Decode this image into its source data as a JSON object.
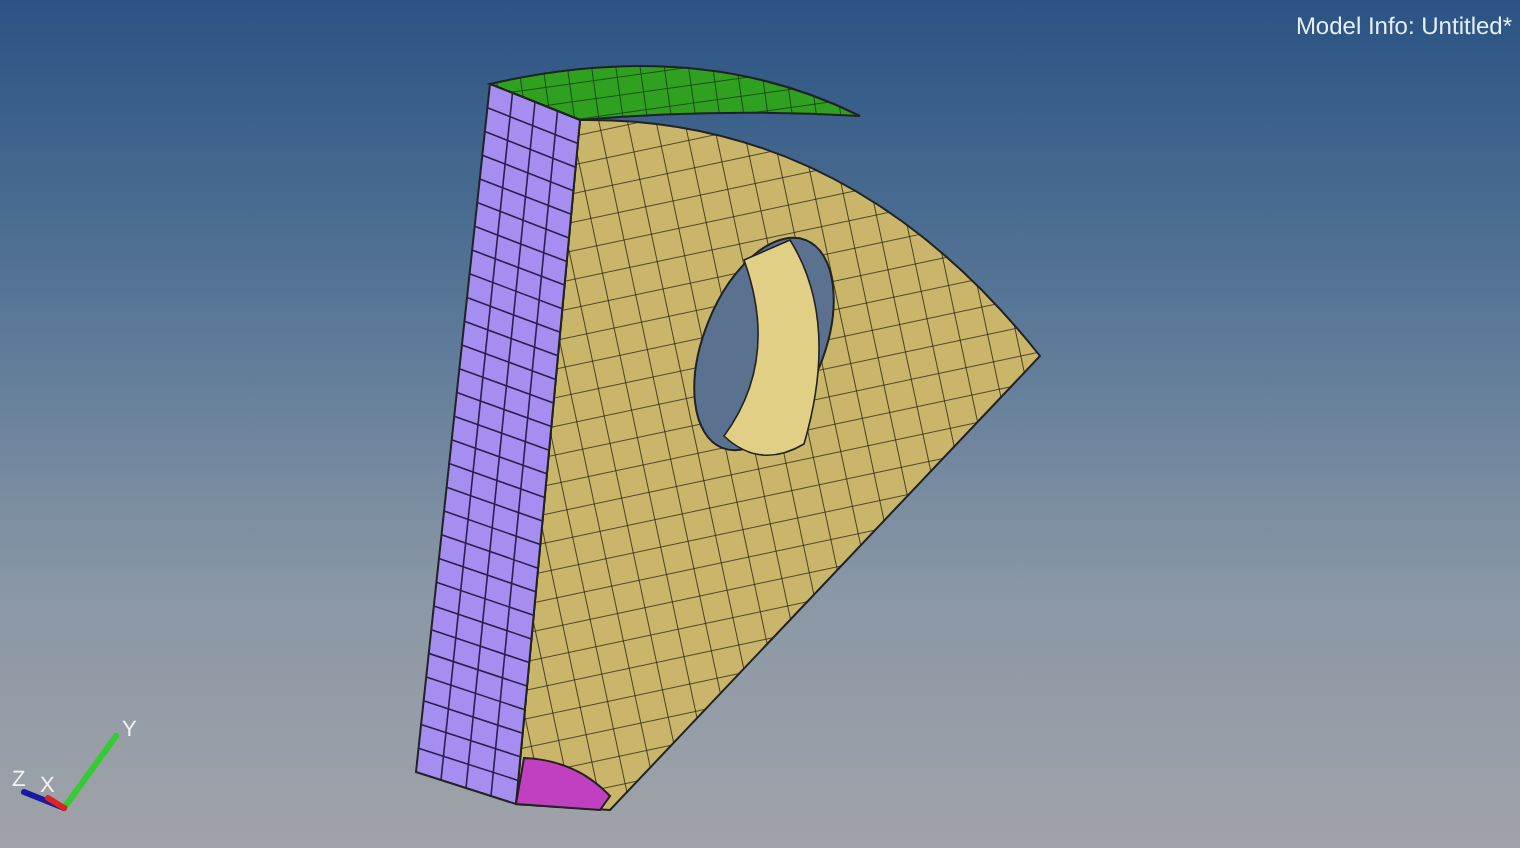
{
  "viewport": {
    "model_info": "Model Info: Untitled*"
  },
  "triad": {
    "axes": [
      {
        "kind": "y",
        "label": "Y",
        "color": "#33cc33"
      },
      {
        "kind": "z",
        "label": "Z",
        "color": "#1a1aa0"
      },
      {
        "kind": "x",
        "label": "X",
        "color": "#dd2222"
      }
    ]
  }
}
